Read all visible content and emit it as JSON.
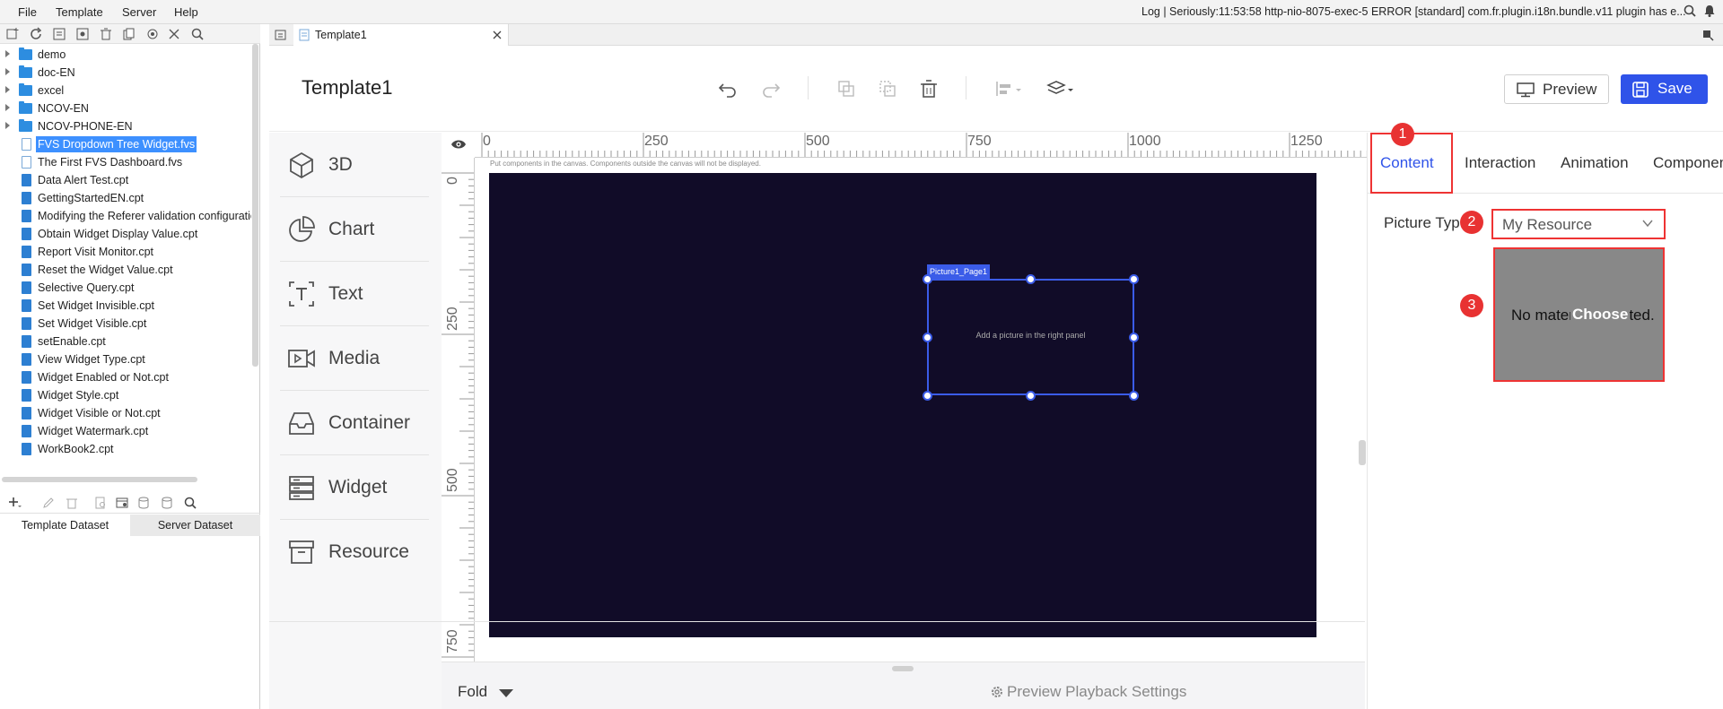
{
  "menubar": {
    "items": [
      "File",
      "Template",
      "Server",
      "Help"
    ],
    "log": "Log | Seriously:11:53:58 http-nio-8075-exec-5 ERROR [standard] com.fr.plugin.i18n.bundle.v11 plugin has e..."
  },
  "tree": {
    "folders": [
      "demo",
      "doc-EN",
      "excel",
      "NCOV-EN",
      "NCOV-PHONE-EN"
    ],
    "files": [
      {
        "name": "FVS Dropdown Tree Widget.fvs",
        "type": "fvs",
        "selected": true
      },
      {
        "name": "The First FVS Dashboard.fvs",
        "type": "fvs",
        "selected": false
      },
      {
        "name": "Data Alert Test.cpt",
        "type": "cpt",
        "selected": false
      },
      {
        "name": "GettingStartedEN.cpt",
        "type": "cpt",
        "selected": false
      },
      {
        "name": "Modifying the Referer validation configuration",
        "type": "cpt",
        "selected": false
      },
      {
        "name": "Obtain Widget Display Value.cpt",
        "type": "cpt",
        "selected": false
      },
      {
        "name": "Report Visit Monitor.cpt",
        "type": "cpt",
        "selected": false
      },
      {
        "name": "Reset the Widget Value.cpt",
        "type": "cpt",
        "selected": false
      },
      {
        "name": "Selective Query.cpt",
        "type": "cpt",
        "selected": false
      },
      {
        "name": "Set Widget Invisible.cpt",
        "type": "cpt",
        "selected": false
      },
      {
        "name": "Set Widget Visible.cpt",
        "type": "cpt",
        "selected": false
      },
      {
        "name": "setEnable.cpt",
        "type": "cpt",
        "selected": false
      },
      {
        "name": "View Widget Type.cpt",
        "type": "cpt",
        "selected": false
      },
      {
        "name": "Widget Enabled or Not.cpt",
        "type": "cpt",
        "selected": false
      },
      {
        "name": "Widget Style.cpt",
        "type": "cpt",
        "selected": false
      },
      {
        "name": "Widget Visible or Not.cpt",
        "type": "cpt",
        "selected": false
      },
      {
        "name": "Widget Watermark.cpt",
        "type": "cpt",
        "selected": false
      },
      {
        "name": "WorkBook2.cpt",
        "type": "cpt",
        "selected": false
      }
    ]
  },
  "dataset_tabs": [
    "Template Dataset",
    "Server Dataset"
  ],
  "tab": {
    "title": "Template1"
  },
  "header": {
    "title": "Template1",
    "preview_label": "Preview",
    "save_label": "Save"
  },
  "palette": [
    "3D",
    "Chart",
    "Text",
    "Media",
    "Container",
    "Widget",
    "Resource"
  ],
  "ruler": {
    "h_labels": [
      "0",
      "250",
      "500",
      "750",
      "1000",
      "1250"
    ],
    "v_labels": [
      "0",
      "250",
      "500",
      "750"
    ]
  },
  "canvas": {
    "hint": "Put components in the canvas. Components outside the canvas will not be displayed.",
    "widget_name": "Picture1_Page1",
    "widget_hint": "Add a picture in the right panel"
  },
  "footer": {
    "fold_label": "Fold",
    "playback_label": "Preview Playback Settings"
  },
  "right_panel": {
    "tabs": [
      "Content",
      "Interaction",
      "Animation",
      "Component"
    ],
    "active_tab": "Content",
    "picture_type_label": "Picture Type",
    "picture_type_value": "My Resource",
    "no_material_text": "No material selected.",
    "choose_label": "Choose",
    "markers": [
      "1",
      "2",
      "3"
    ]
  },
  "colors": {
    "accent": "#2f53e9",
    "canvas_bg": "#110c28",
    "annotation_red": "#e83232",
    "selection": "#3d90ff"
  }
}
